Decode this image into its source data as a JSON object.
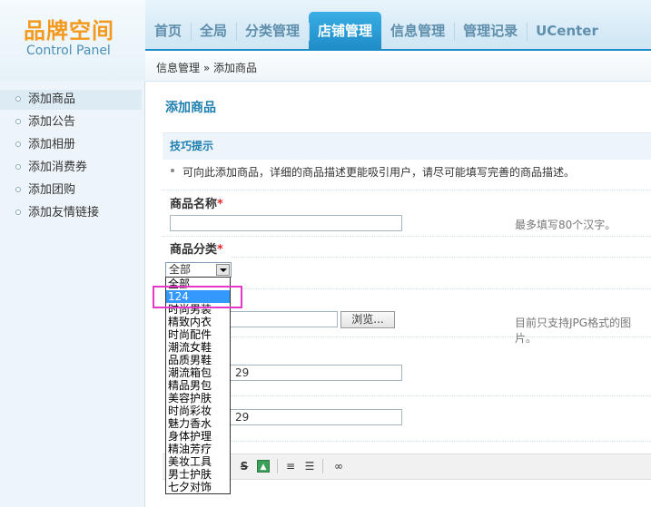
{
  "logo": {
    "title": "品牌空间",
    "subtitle": "Control Panel"
  },
  "nav": {
    "items": [
      {
        "label": "首页"
      },
      {
        "label": "全局"
      },
      {
        "label": "分类管理"
      },
      {
        "label": "店铺管理",
        "active": true
      },
      {
        "label": "信息管理"
      },
      {
        "label": "管理记录"
      },
      {
        "label": "UCenter"
      }
    ]
  },
  "breadcrumb": "信息管理 » 添加商品",
  "sidebar": {
    "items": [
      {
        "label": "添加商品",
        "active": true
      },
      {
        "label": "添加公告"
      },
      {
        "label": "添加相册"
      },
      {
        "label": "添加消费券"
      },
      {
        "label": "添加团购"
      },
      {
        "label": "添加友情链接"
      }
    ]
  },
  "main": {
    "title": "添加商品",
    "tips_title": "技巧提示",
    "tip": "可向此添加商品，详细的商品描述更能吸引用户，请尽可能填写完善的商品描述。",
    "name_label": "商品名称",
    "name_hint": "最多填写80个汉字。",
    "category_label": "商品分类",
    "category_selected": "全部",
    "image_hint": "目前只支持JPG格式的图片。",
    "browse_label": "浏览...",
    "field_value_1": "29",
    "field_value_2": "29",
    "required_mark": "*"
  },
  "dropdown": {
    "options": [
      "全部",
      "124",
      "时尚男装",
      "精致内衣",
      "时尚配件",
      "潮流女鞋",
      "品质男鞋",
      "潮流箱包",
      "精品男包",
      "美容护肤",
      "时尚彩妆",
      "魅力香水",
      "身体护理",
      "精油芳疗",
      "美妆工具",
      "男士护肤",
      "七夕对饰"
    ],
    "highlighted": "124"
  },
  "toolbar": {
    "icons": [
      "strikethrough-icon",
      "image-icon",
      "align-icon",
      "list-icon",
      "link-icon"
    ]
  },
  "colors": {
    "accent": "#1e8bc6",
    "logo": "#f39a1e",
    "highlight": "#e637c8",
    "selected_option": "#3399ff"
  }
}
